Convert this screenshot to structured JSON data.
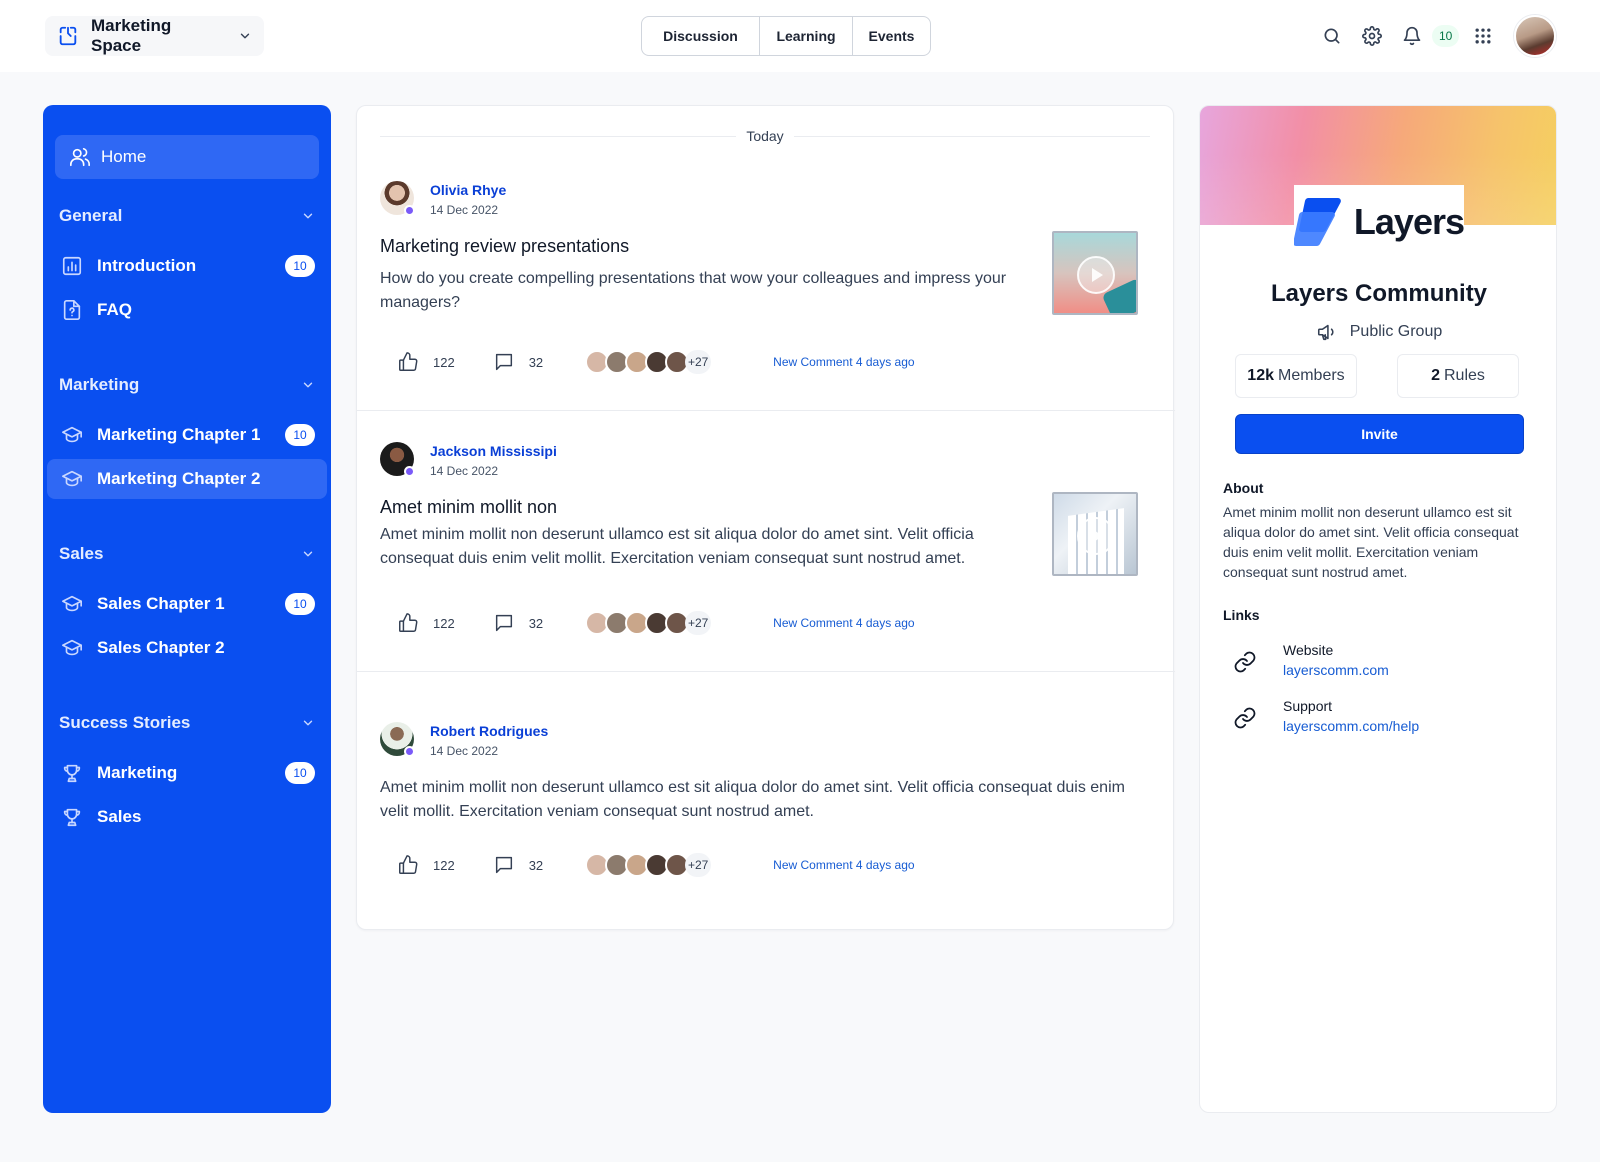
{
  "topbar": {
    "space_name": "Marketing Space",
    "tabs": [
      "Discussion",
      "Learning",
      "Events"
    ],
    "notification_count": "10"
  },
  "sidebar": {
    "home": "Home",
    "sections": [
      {
        "title": "General",
        "items": [
          {
            "label": "Introduction",
            "badge": "10"
          },
          {
            "label": "FAQ"
          }
        ]
      },
      {
        "title": "Marketing",
        "items": [
          {
            "label": "Marketing Chapter 1",
            "badge": "10"
          },
          {
            "label": "Marketing Chapter 2"
          }
        ]
      },
      {
        "title": "Sales",
        "items": [
          {
            "label": "Sales Chapter 1",
            "badge": "10"
          },
          {
            "label": "Sales Chapter 2"
          }
        ]
      },
      {
        "title": "Success Stories",
        "items": [
          {
            "label": "Marketing",
            "badge": "10"
          },
          {
            "label": "Sales"
          }
        ]
      }
    ]
  },
  "feed": {
    "date_label": "Today",
    "posts": [
      {
        "author": "Olivia Rhye",
        "date": "14 Dec 2022",
        "title": "Marketing review presentations",
        "body": "How do you create compelling presentations that wow your colleagues and impress your managers?",
        "likes": "122",
        "comments": "32",
        "more_participants": "+27",
        "activity": "New Comment 4 days ago"
      },
      {
        "author": "Jackson Mississipi",
        "date": "14 Dec 2022",
        "title": "Amet minim mollit non",
        "body": "Amet minim mollit non deserunt ullamco est sit aliqua dolor do amet sint. Velit officia consequat duis enim velit mollit. Exercitation veniam consequat sunt nostrud amet.",
        "likes": "122",
        "comments": "32",
        "more_participants": "+27",
        "activity": "New Comment 4 days ago"
      },
      {
        "author": "Robert Rodrigues",
        "date": "14 Dec 2022",
        "body": "Amet minim mollit non deserunt ullamco est sit aliqua dolor do amet sint. Velit officia consequat duis enim velit mollit. Exercitation veniam consequat sunt nostrud amet.",
        "likes": "122",
        "comments": "32",
        "more_participants": "+27",
        "activity": "New Comment 4 days ago"
      }
    ]
  },
  "community": {
    "brand_word": "Layers",
    "name": "Layers Community",
    "type": "Public Group",
    "members_count": "12k",
    "members_label": "Members",
    "rules_count": "2",
    "rules_label": "Rules",
    "invite_label": "Invite",
    "about_label": "About",
    "about_text": "Amet minim mollit non deserunt ullamco est sit aliqua dolor do amet sint. Velit officia consequat duis enim velit mollit. Exercitation veniam consequat sunt nostrud amet.",
    "links_label": "Links",
    "links": [
      {
        "title": "Website",
        "url": "layerscomm.com"
      },
      {
        "title": "Support",
        "url": "layerscomm.com/help"
      }
    ]
  },
  "colors": {
    "primary": "#0a4ff0",
    "link": "#175cd3",
    "author": "#0a3fd6"
  }
}
